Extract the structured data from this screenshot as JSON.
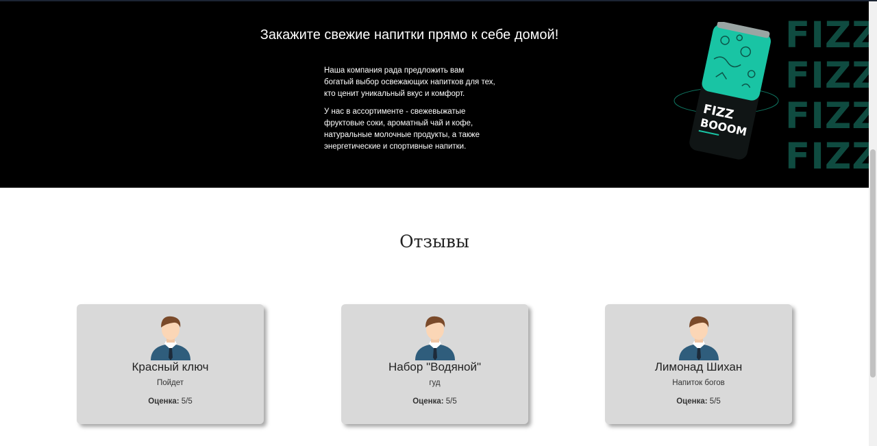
{
  "hero": {
    "title": "Закажите свежие напитки прямо к себе домой!",
    "paragraph1": "Наша компания рада предложить вам богатый выбор освежающих напитков для тех, кто ценит уникальный вкус и комфорт.",
    "paragraph2": "У нас в ассортименте - свежевыжатые фруктовые соки, ароматный чай и кофе, натуральные молочные продукты, а также энергетические и спортивные напитки.",
    "brand_word": "FIZZ",
    "can_label_line1": "FIZZ",
    "can_label_line2": "BOOOM",
    "colors": {
      "background": "#000000",
      "can_teal": "#19c4a4",
      "fizz_text": "#0f4b40"
    }
  },
  "reviews": {
    "title": "Отзывы",
    "rating_label": "Оценка:",
    "items": [
      {
        "product": "Красный ключ",
        "text": "Пойдет",
        "score": "5/5"
      },
      {
        "product": "Набор \"Водяной\"",
        "text": "гуд",
        "score": "5/5"
      },
      {
        "product": "Лимонад Шихан",
        "text": "Напиток богов",
        "score": "5/5"
      }
    ]
  }
}
